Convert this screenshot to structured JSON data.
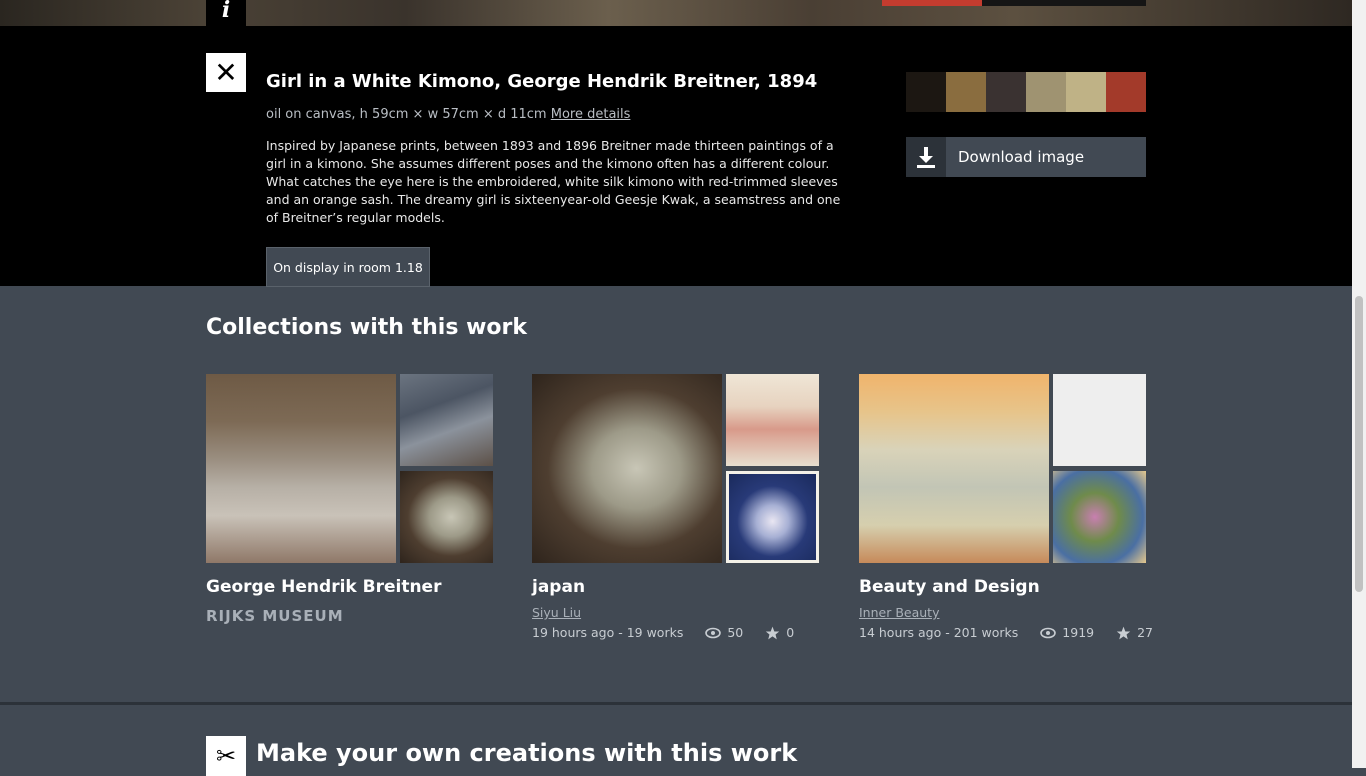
{
  "artwork": {
    "title": "Girl in a White Kimono, George Hendrik Breitner, 1894",
    "meta": "oil on canvas, h 59cm × w 57cm × d 11cm",
    "more_details": "More details",
    "description": "Inspired by Japanese prints, between 1893 and 1896 Breitner made thirteen paintings of a girl in a kimono. She assumes different poses and the kimono often has a different colour. What catches the eye here is the embroidered, white silk kimono with red-trimmed sleeves and an orange sash. The dreamy girl is sixteenyear-old Geesje Kwak, a seamstress and one of Breitner’s regular models.",
    "room_button": "On display in room 1.18",
    "swatch_colors": [
      "#1c1712",
      "#8a6d3f",
      "#3a3231",
      "#9f9371",
      "#bfb286",
      "#a33a2a"
    ],
    "download_label": "Download image",
    "icons": {
      "info": "i",
      "close": "✕",
      "scissors": "✂"
    }
  },
  "collections": {
    "heading": "Collections with this work",
    "items": [
      {
        "name": "George Hendrik Breitner",
        "owner_logo": "RIJKS MUSEUM"
      },
      {
        "name": "japan",
        "owner": "Siyu Liu",
        "meta": "19 hours ago - 19 works",
        "views": "50",
        "stars": "0"
      },
      {
        "name": "Beauty and Design",
        "owner": "Inner Beauty",
        "meta": "14 hours ago - 201 works",
        "views": "1919",
        "stars": "27"
      }
    ]
  },
  "creations": {
    "heading": "Make your own creations with this work"
  }
}
